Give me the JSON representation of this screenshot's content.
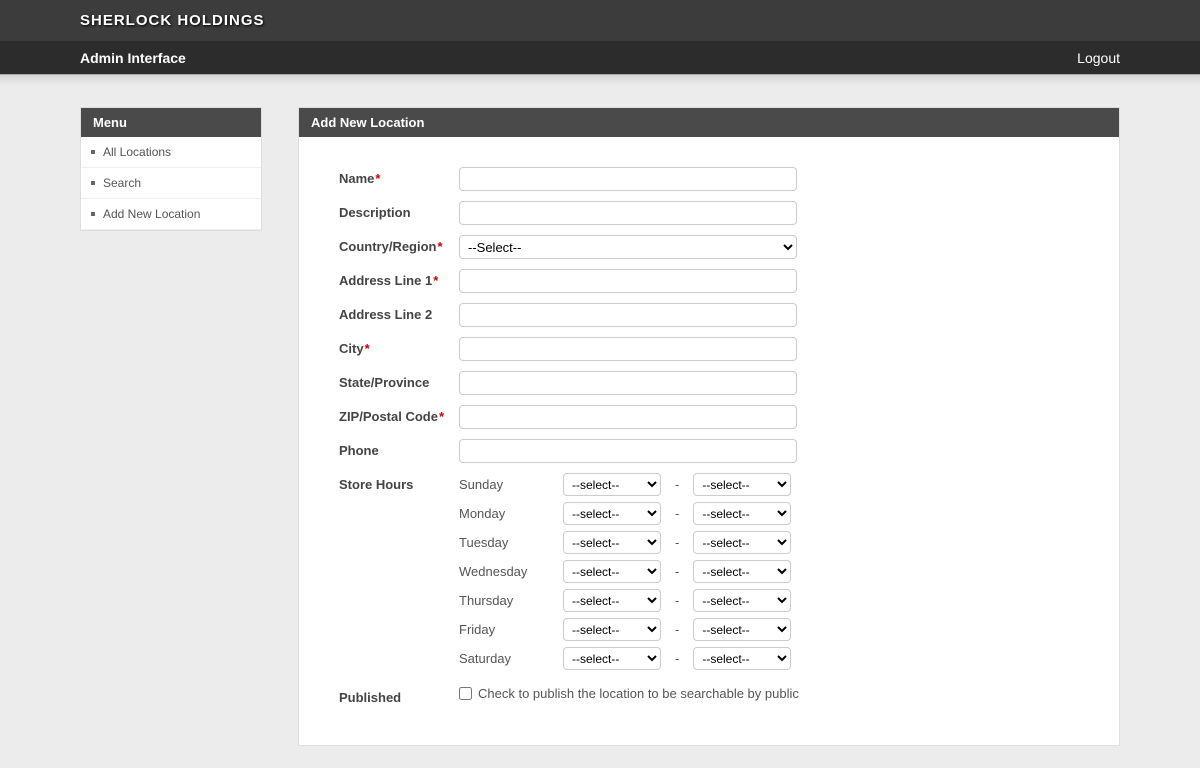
{
  "brand": "SHERLOCK HOLDINGS",
  "nav": {
    "title": "Admin Interface",
    "logout": "Logout"
  },
  "sidebar": {
    "header": "Menu",
    "items": [
      "All Locations",
      "Search",
      "Add New Location"
    ]
  },
  "page": {
    "header": "Add New Location"
  },
  "form": {
    "labels": {
      "name": "Name",
      "description": "Description",
      "country": "Country/Region",
      "addr1": "Address Line 1",
      "addr2": "Address Line 2",
      "city": "City",
      "state": "State/Province",
      "zip": "ZIP/Postal Code",
      "phone": "Phone",
      "hours": "Store Hours",
      "published": "Published"
    },
    "required": {
      "name": true,
      "country": true,
      "addr1": true,
      "city": true,
      "zip": true
    },
    "country_placeholder": "--Select--",
    "hours_placeholder": "--select--",
    "days": [
      "Sunday",
      "Monday",
      "Tuesday",
      "Wednesday",
      "Thursday",
      "Friday",
      "Saturday"
    ],
    "dash": "-",
    "published_text": "Check to publish the location to be searchable by public"
  }
}
